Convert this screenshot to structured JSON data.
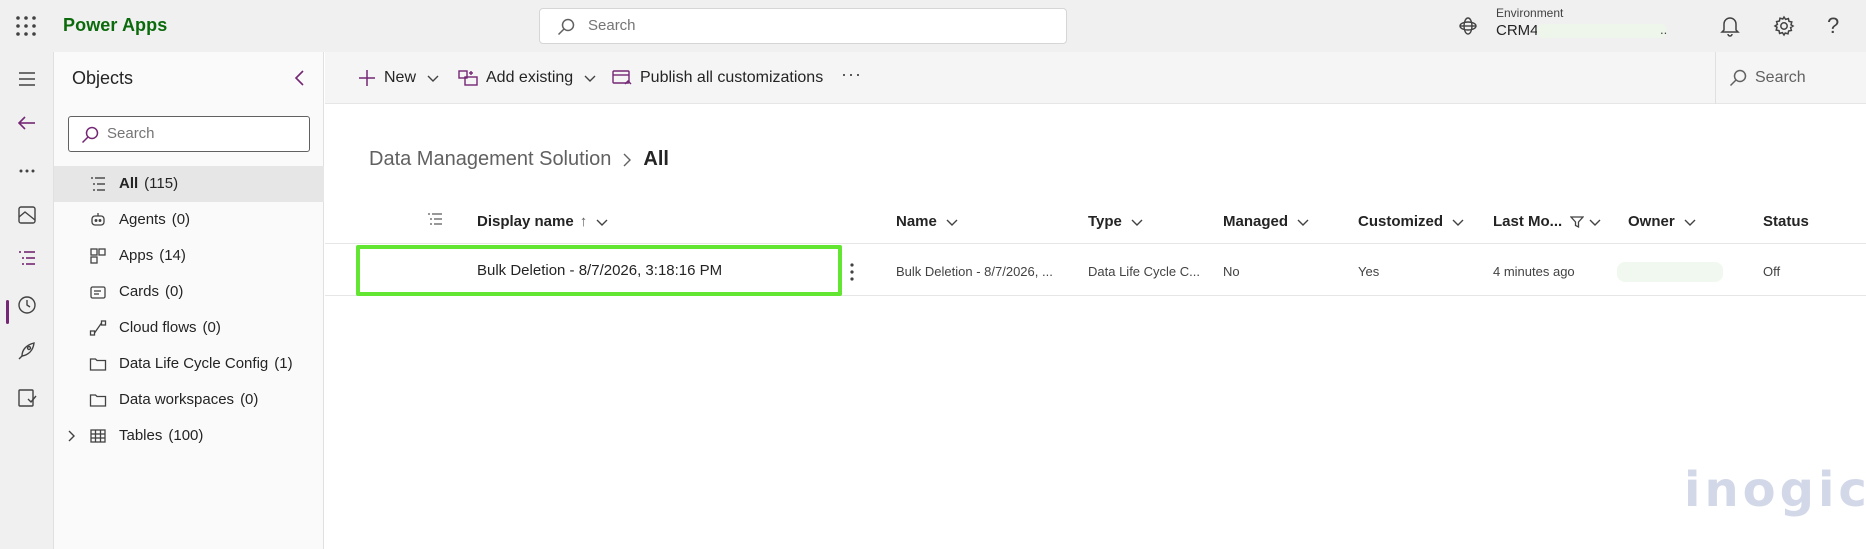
{
  "topbar": {
    "app_name": "Power Apps",
    "search_placeholder": "Search",
    "environment_label": "Environment",
    "environment_name": "CRM4",
    "environment_suffix": "..",
    "help_glyph": "?"
  },
  "objects_panel": {
    "title": "Objects",
    "search_placeholder": "Search",
    "items": [
      {
        "label": "All",
        "count": "(115)",
        "icon": "list-icon",
        "active": true
      },
      {
        "label": "Agents",
        "count": "(0)",
        "icon": "agent-icon"
      },
      {
        "label": "Apps",
        "count": "(14)",
        "icon": "apps-icon"
      },
      {
        "label": "Cards",
        "count": "(0)",
        "icon": "card-icon"
      },
      {
        "label": "Cloud flows",
        "count": "(0)",
        "icon": "flow-icon"
      },
      {
        "label": "Data Life Cycle Config",
        "count": "(1)",
        "icon": "folder-icon"
      },
      {
        "label": "Data workspaces",
        "count": "(0)",
        "icon": "folder-icon"
      },
      {
        "label": "Tables",
        "count": "(100)",
        "icon": "table-icon",
        "expandable": true
      }
    ]
  },
  "commandbar": {
    "new_label": "New",
    "add_existing_label": "Add existing",
    "publish_label": "Publish all customizations",
    "more_label": "···",
    "search_label": "Search"
  },
  "breadcrumb": {
    "solution": "Data Management Solution",
    "separator": ">",
    "current": "All"
  },
  "grid": {
    "columns": {
      "display_name": "Display name",
      "sort_indicator": "↑",
      "name": "Name",
      "type": "Type",
      "managed": "Managed",
      "customized": "Customized",
      "last_modified": "Last Mo...",
      "owner": "Owner",
      "status": "Status"
    },
    "rows": [
      {
        "display_name": "Bulk Deletion - 8/7/2026, 3:18:16 PM",
        "name": "Bulk Deletion - 8/7/2026, ...",
        "type": "Data Life Cycle C...",
        "managed": "No",
        "customized": "Yes",
        "last_modified": "4 minutes ago",
        "owner": "",
        "status": "Off"
      }
    ]
  },
  "watermark": "inogic",
  "colors": {
    "brand": "#0b6a0b",
    "accent": "#742774",
    "highlight": "#62e632"
  }
}
